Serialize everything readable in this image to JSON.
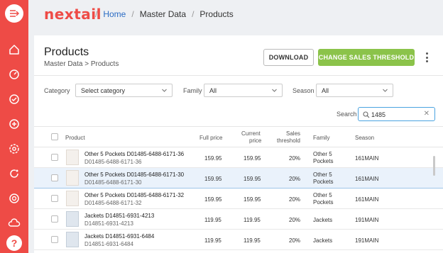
{
  "brand": {
    "logo_text": "nextail",
    "accent": "#ee4b46",
    "green": "#8bc34a",
    "link": "#2b6cc4"
  },
  "sidebar": {
    "items": [
      {
        "icon": "menu-icon"
      },
      {
        "icon": "home-icon"
      },
      {
        "icon": "dashboard-icon"
      },
      {
        "icon": "check-circle-icon"
      },
      {
        "icon": "add-circle-icon"
      },
      {
        "icon": "settings-search-icon"
      },
      {
        "icon": "refresh-icon"
      },
      {
        "icon": "target-icon"
      },
      {
        "icon": "cloud-sync-icon"
      }
    ],
    "help": "?"
  },
  "breadcrumb": {
    "home": "Home",
    "section": "Master Data",
    "current": "Products"
  },
  "page": {
    "title": "Products",
    "subtitle": "Master Data > Products",
    "download_label": "DOWNLOAD",
    "threshold_label": "CHANGE SALES THRESHOLD"
  },
  "filters": {
    "category_label": "Category",
    "category_value": "Select category",
    "family_label": "Family",
    "family_value": "All",
    "season_label": "Season",
    "season_value": "All",
    "search_label": "Search",
    "search_value": "1485"
  },
  "table": {
    "headers": {
      "product": "Product",
      "full_price": "Full price",
      "current_price_1": "Current",
      "current_price_2": "price",
      "sales_1": "Sales",
      "sales_2": "threshold",
      "family": "Family",
      "season": "Season"
    },
    "rows": [
      {
        "name": "Other 5 Pockets D01485-6488-6171-36",
        "code": "D01485-6488-6171-36",
        "full": "159.95",
        "current": "159.95",
        "threshold": "20%",
        "family_1": "Other 5",
        "family_2": "Pockets",
        "season": "161MAIN",
        "selected": false
      },
      {
        "name": "Other 5 Pockets D01485-6488-6171-30",
        "code": "D01485-6488-6171-30",
        "full": "159.95",
        "current": "159.95",
        "threshold": "20%",
        "family_1": "Other 5",
        "family_2": "Pockets",
        "season": "161MAIN",
        "selected": true
      },
      {
        "name": "Other 5 Pockets D01485-6488-6171-32",
        "code": "D01485-6488-6171-32",
        "full": "159.95",
        "current": "159.95",
        "threshold": "20%",
        "family_1": "Other 5",
        "family_2": "Pockets",
        "season": "161MAIN",
        "selected": false
      },
      {
        "name": "Jackets D14851-6931-4213",
        "code": "D14851-6931-4213",
        "full": "119.95",
        "current": "119.95",
        "threshold": "20%",
        "family_1": "Jackets",
        "family_2": "",
        "season": "191MAIN",
        "selected": false
      },
      {
        "name": "Jackets D14851-6931-6484",
        "code": "D14851-6931-6484",
        "full": "119.95",
        "current": "119.95",
        "threshold": "20%",
        "family_1": "Jackets",
        "family_2": "",
        "season": "191MAIN",
        "selected": false
      }
    ]
  }
}
